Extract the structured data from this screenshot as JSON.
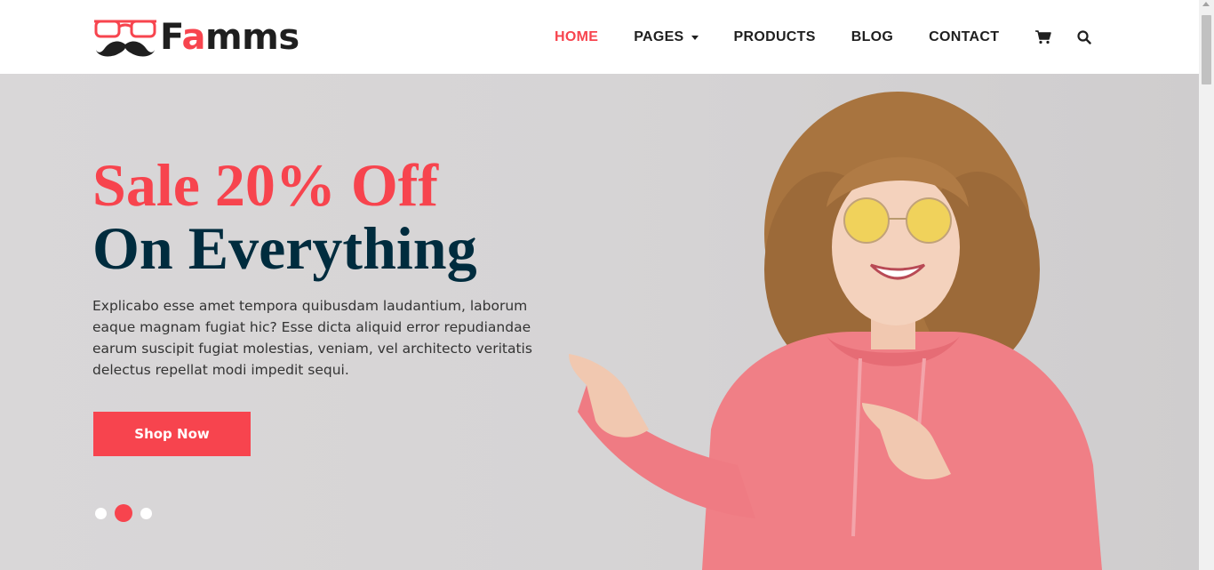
{
  "brand": {
    "name_prefix": "F",
    "name_accent": "a",
    "name_suffix": "mms",
    "accent_color": "#f7444e",
    "dark_color": "#002c3e"
  },
  "nav": {
    "items": [
      {
        "label": "HOME",
        "active": true
      },
      {
        "label": "PAGES",
        "dropdown": true
      },
      {
        "label": "PRODUCTS"
      },
      {
        "label": "BLOG"
      },
      {
        "label": "CONTACT"
      }
    ],
    "icons": [
      "cart-icon",
      "search-icon"
    ]
  },
  "hero": {
    "heading_line1": "Sale 20% Off",
    "heading_line2": "On Everything",
    "description": "Explicabo esse amet tempora quibusdam laudantium, laborum eaque magnam fugiat hic? Esse dicta aliquid error repudiandae earum suscipit fugiat molestias, veniam, vel architecto veritatis delectus repellat modi impedit sequi.",
    "cta_label": "Shop Now",
    "slides": 3,
    "active_slide": 2
  }
}
